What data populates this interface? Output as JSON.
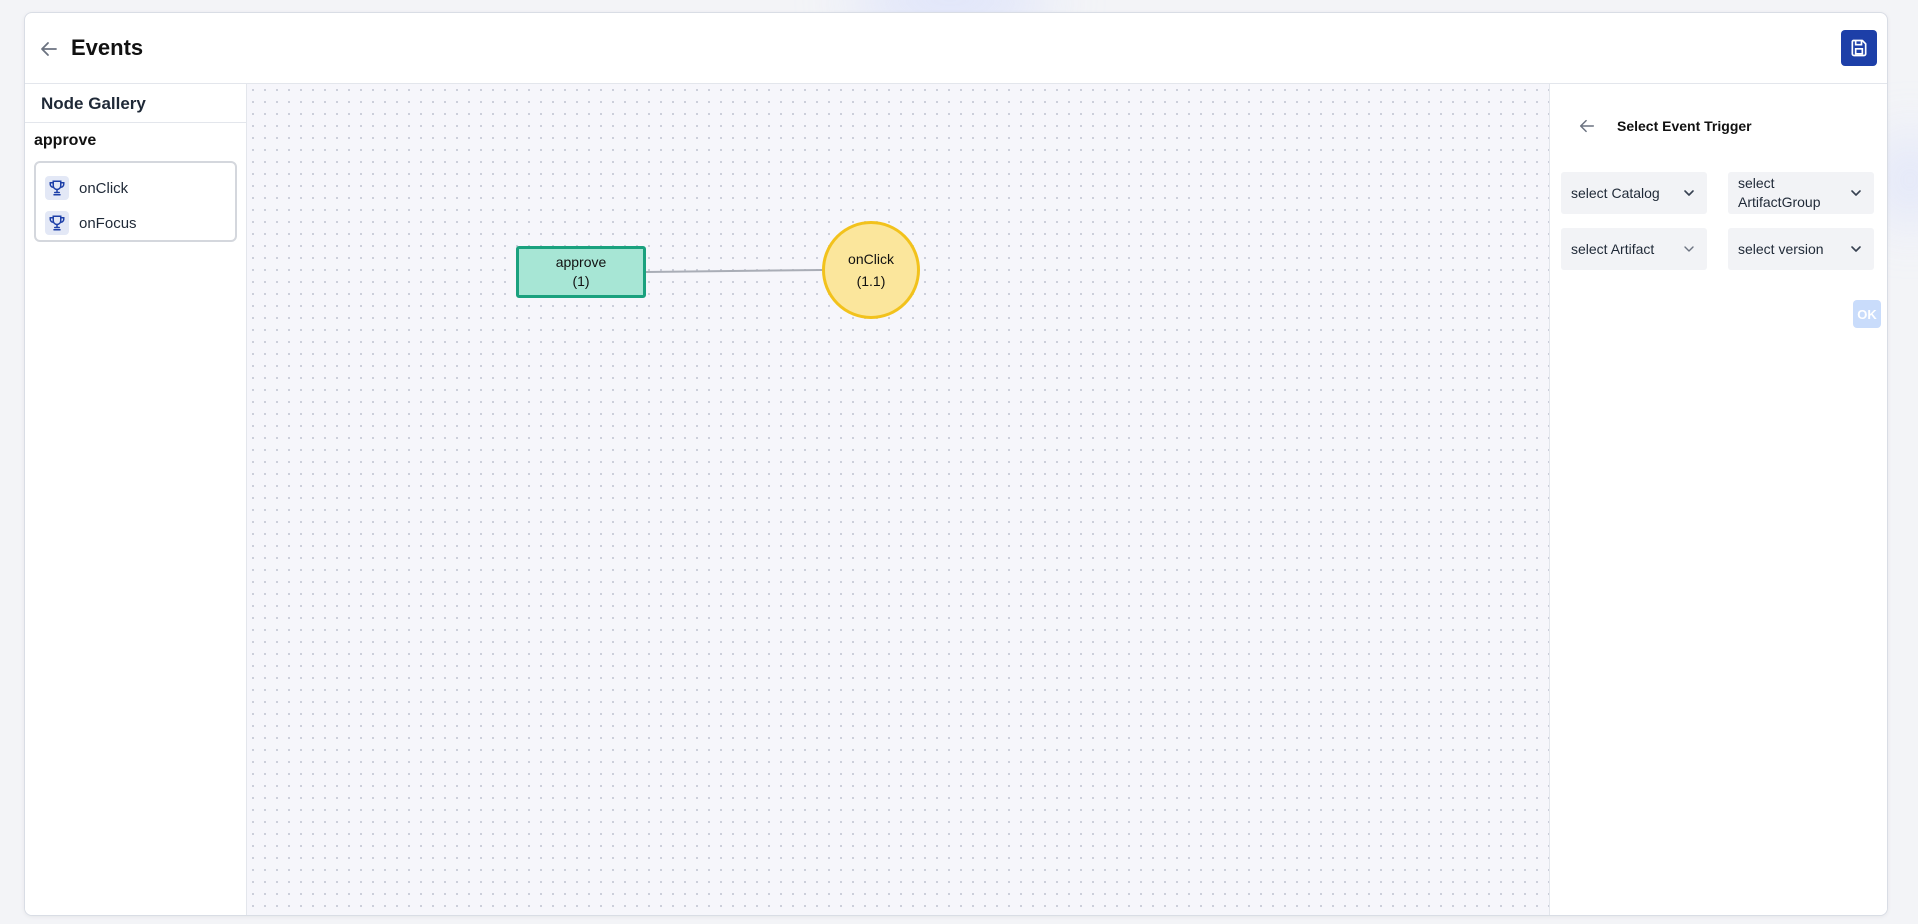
{
  "header": {
    "title": "Events",
    "back_icon": "arrow-left-icon",
    "save_icon": "floppy-disk-icon"
  },
  "sidebar": {
    "title": "Node Gallery",
    "group": "approve",
    "items": [
      {
        "label": "onClick",
        "icon": "trophy-icon"
      },
      {
        "label": "onFocus",
        "icon": "trophy-icon"
      }
    ]
  },
  "canvas": {
    "nodes": [
      {
        "label": "approve",
        "sub": "(1)",
        "shape": "rectangle"
      },
      {
        "label": "onClick",
        "sub": "(1.1)",
        "shape": "circle"
      }
    ]
  },
  "panel": {
    "title": "Select Event Trigger",
    "catalog": "select Catalog",
    "artifact_group": "select ArtifactGroup",
    "artifact": "select Artifact",
    "version": "select version",
    "ok": "OK"
  },
  "colors": {
    "accent": "#1d3fa8",
    "rect_fill": "#a7e6d5",
    "rect_border": "#1aa17e",
    "circle_fill": "#fbe69c",
    "circle_border": "#f2c21c",
    "ok_disabled": "#c9dcfb"
  }
}
